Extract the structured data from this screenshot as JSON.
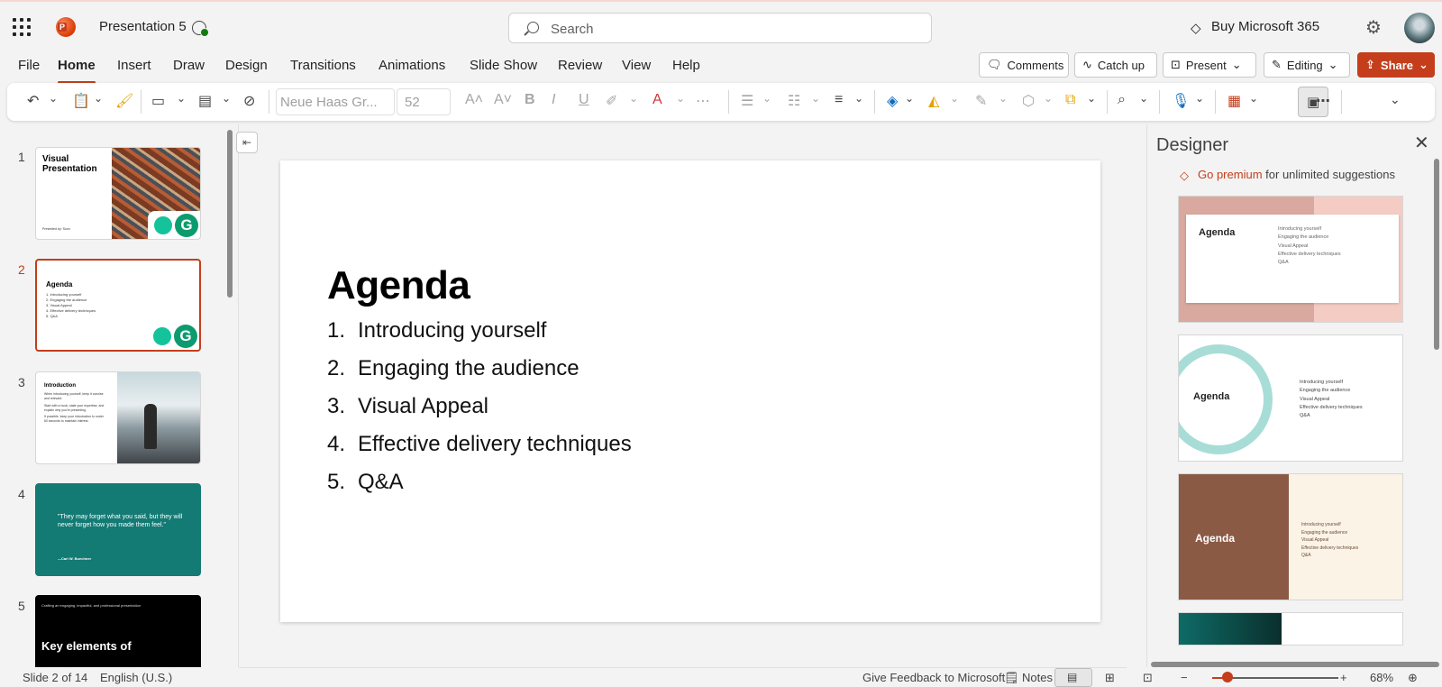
{
  "app": {
    "doc_title": "Presentation 5",
    "search_placeholder": "Search",
    "buy_label": "Buy Microsoft 365"
  },
  "menu": {
    "tabs": [
      "File",
      "Home",
      "Insert",
      "Draw",
      "Design",
      "Transitions",
      "Animations",
      "Slide Show",
      "Review",
      "View",
      "Help"
    ],
    "active_tab": "Home",
    "comments": "Comments",
    "catchup": "Catch up",
    "present": "Present",
    "editing": "Editing",
    "share": "Share"
  },
  "ribbon": {
    "font_name": "Neue Haas Gr...",
    "font_size": "52"
  },
  "thumbnails": [
    {
      "num": "1",
      "title": "Visual Presentation",
      "footer": "Presented by: Soon"
    },
    {
      "num": "2",
      "title": "Agenda",
      "items": [
        "1.  Introducing yourself",
        "2.  Engaging the audience",
        "3.  Visual Appeal",
        "4.  Effective delivery techniques",
        "5.  Q&A"
      ]
    },
    {
      "num": "3",
      "title": "Introduction",
      "lines": [
        "When introducing yourself, keep it concise and relevant.",
        "Start with a hook, state your expertise, and explain why you're presenting.",
        "If possible, keep your introduction to under 60 seconds to maintain interest."
      ]
    },
    {
      "num": "4",
      "quote": "\"They may forget what you said, but they will never forget how you made them feel.\"",
      "author": "—Carl W. Buechner"
    },
    {
      "num": "5",
      "kicker": "Crafting an engaging, impactful, and professional presentation",
      "title": "Key elements of"
    }
  ],
  "slide": {
    "title": "Agenda",
    "items": [
      {
        "num": "1.",
        "text": "Introducing yourself"
      },
      {
        "num": "2.",
        "text": "Engaging the audience"
      },
      {
        "num": "3.",
        "text": "Visual Appeal"
      },
      {
        "num": "4.",
        "text": "Effective delivery techniques"
      },
      {
        "num": "5.",
        "text": "Q&A"
      }
    ]
  },
  "designer": {
    "title": "Designer",
    "premium_link": "Go premium",
    "premium_text": "for unlimited suggestions",
    "card_title": "Agenda",
    "card_items": [
      "Introducing yourself",
      "Engaging the audience",
      "Visual Appeal",
      "Effective delivery techniques",
      "Q&A"
    ]
  },
  "status": {
    "slide_info": "Slide 2 of 14",
    "language": "English (U.S.)",
    "feedback": "Give Feedback to Microsoft",
    "notes": "Notes",
    "zoom": "68%"
  },
  "colors": {
    "accent": "#c43e1c",
    "teal": "#137a74"
  }
}
